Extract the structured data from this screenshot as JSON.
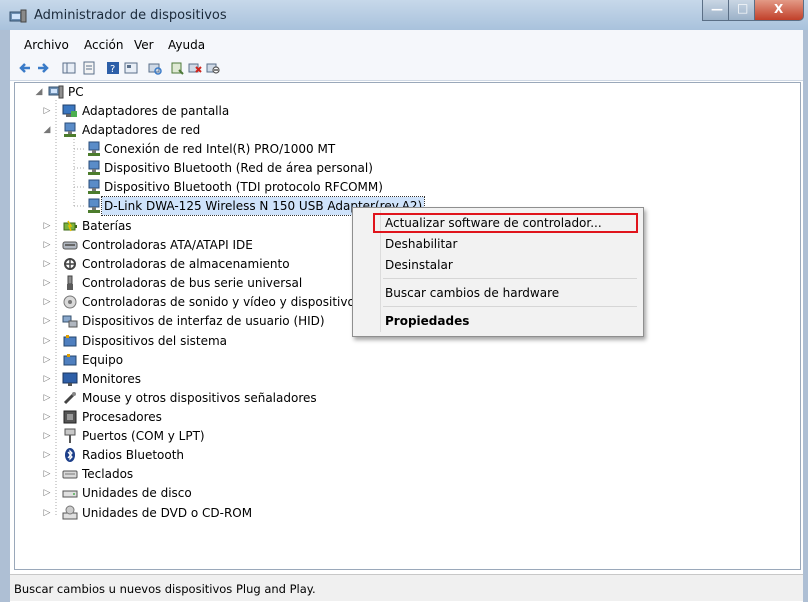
{
  "window": {
    "title": "Administrador de dispositivos",
    "controls": {
      "minimize": "—",
      "maximize": "□",
      "close": "X"
    }
  },
  "menubar": [
    "Archivo",
    "Acción",
    "Ver",
    "Ayuda"
  ],
  "toolbar": {
    "icons": [
      "back-arrow-icon",
      "forward-arrow-icon",
      "show-hide-tree-icon",
      "properties-icon",
      "help-icon",
      "show-hidden-icon",
      "scan-hardware-icon",
      "update-driver-icon",
      "uninstall-icon",
      "disable-icon"
    ]
  },
  "tree": {
    "root": "PC",
    "categories": [
      {
        "label": "Adaptadores de pantalla",
        "icon": "display-adapter-icon"
      },
      {
        "label": "Adaptadores de red",
        "icon": "network-adapter-icon",
        "expanded": true,
        "children": [
          {
            "label": "Conexión de red Intel(R) PRO/1000 MT"
          },
          {
            "label": "Dispositivo Bluetooth (Red de área personal)"
          },
          {
            "label": "Dispositivo Bluetooth (TDI protocolo RFCOMM)"
          },
          {
            "label": "D-Link DWA-125 Wireless N 150 USB Adapter(rev.A2)",
            "selected": true
          }
        ]
      },
      {
        "label": "Baterías",
        "icon": "battery-icon"
      },
      {
        "label": "Controladoras ATA/ATAPI IDE",
        "icon": "ide-controller-icon"
      },
      {
        "label": "Controladoras de almacenamiento",
        "icon": "storage-controller-icon"
      },
      {
        "label": "Controladoras de bus serie universal",
        "icon": "usb-controller-icon"
      },
      {
        "label": "Controladoras de sonido y vídeo y dispositivos de juego",
        "icon": "sound-video-icon"
      },
      {
        "label": "Dispositivos de interfaz de usuario (HID)",
        "icon": "hid-icon"
      },
      {
        "label": "Dispositivos del sistema",
        "icon": "system-devices-icon"
      },
      {
        "label": "Equipo",
        "icon": "computer-icon"
      },
      {
        "label": "Monitores",
        "icon": "monitor-icon"
      },
      {
        "label": "Mouse y otros dispositivos señaladores",
        "icon": "mouse-icon"
      },
      {
        "label": "Procesadores",
        "icon": "processor-icon"
      },
      {
        "label": "Puertos (COM y LPT)",
        "icon": "port-icon"
      },
      {
        "label": "Radios Bluetooth",
        "icon": "bluetooth-icon"
      },
      {
        "label": "Teclados",
        "icon": "keyboard-icon"
      },
      {
        "label": "Unidades de disco",
        "icon": "disk-drive-icon"
      },
      {
        "label": "Unidades de DVD o CD-ROM",
        "icon": "dvd-drive-icon"
      }
    ]
  },
  "context_menu": {
    "items": [
      {
        "label": "Actualizar software de controlador...",
        "highlighted": true
      },
      {
        "label": "Deshabilitar"
      },
      {
        "label": "Desinstalar"
      },
      {
        "label": "Buscar cambios de hardware"
      },
      {
        "label": "Propiedades",
        "bold": true
      }
    ],
    "highlight_color": "#e0141c"
  },
  "statusbar": {
    "text": "Buscar cambios u nuevos dispositivos Plug and Play."
  },
  "colors": {
    "titlebar": "#b8cde3",
    "selection": "#cfe3fb",
    "highlight_border": "#e0141c"
  }
}
